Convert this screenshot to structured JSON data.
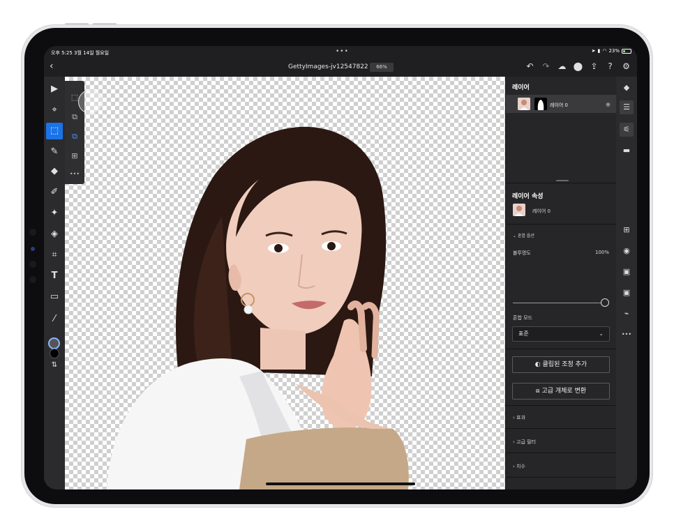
{
  "status_bar": {
    "time": "오후 5:25  3월 14일 월요일",
    "dots": "•••",
    "battery": "23%"
  },
  "header": {
    "back": "‹",
    "title": "GettyImages-jv12547822 *",
    "zoom": "66%",
    "actions": [
      "↶",
      "↷",
      "☁",
      "⬤",
      "⇪",
      "?",
      "⚙"
    ]
  },
  "toolbar": {
    "tools": [
      "▶",
      "⌖",
      "⬚",
      "✎",
      "◆",
      "✐",
      "✦",
      "◈",
      "⌗",
      "T",
      "▭",
      "⁄",
      "⇅"
    ]
  },
  "flyout": {
    "items": [
      "⬚",
      "⧉",
      "⧉",
      "⊞",
      "•••"
    ]
  },
  "layers_panel": {
    "title": "레이어",
    "layer_name": "레이어 0"
  },
  "properties": {
    "title": "레이어 속성",
    "layer_name": "레이어 0",
    "blend_options": "혼합 옵션",
    "opacity_label": "불투명도",
    "opacity_value": "100%",
    "opacity": 1.0,
    "blend_mode_label": "혼합 모드",
    "blend_mode_value": "표준",
    "clipped_adjust_button": "클립된 조정 추가",
    "smart_object_button": "고급 개체로 변환",
    "sections": [
      "효과",
      "고급 필터",
      "치수"
    ]
  },
  "right_rail": {
    "icons": [
      "◆",
      "☰",
      "⚟",
      "▬",
      "⊞",
      "◉",
      "▣",
      "▣",
      "⌁",
      "•••"
    ]
  },
  "colors": {
    "accent": "#1a73e8",
    "panel": "#262628",
    "toolbar": "#2b2b2d"
  }
}
